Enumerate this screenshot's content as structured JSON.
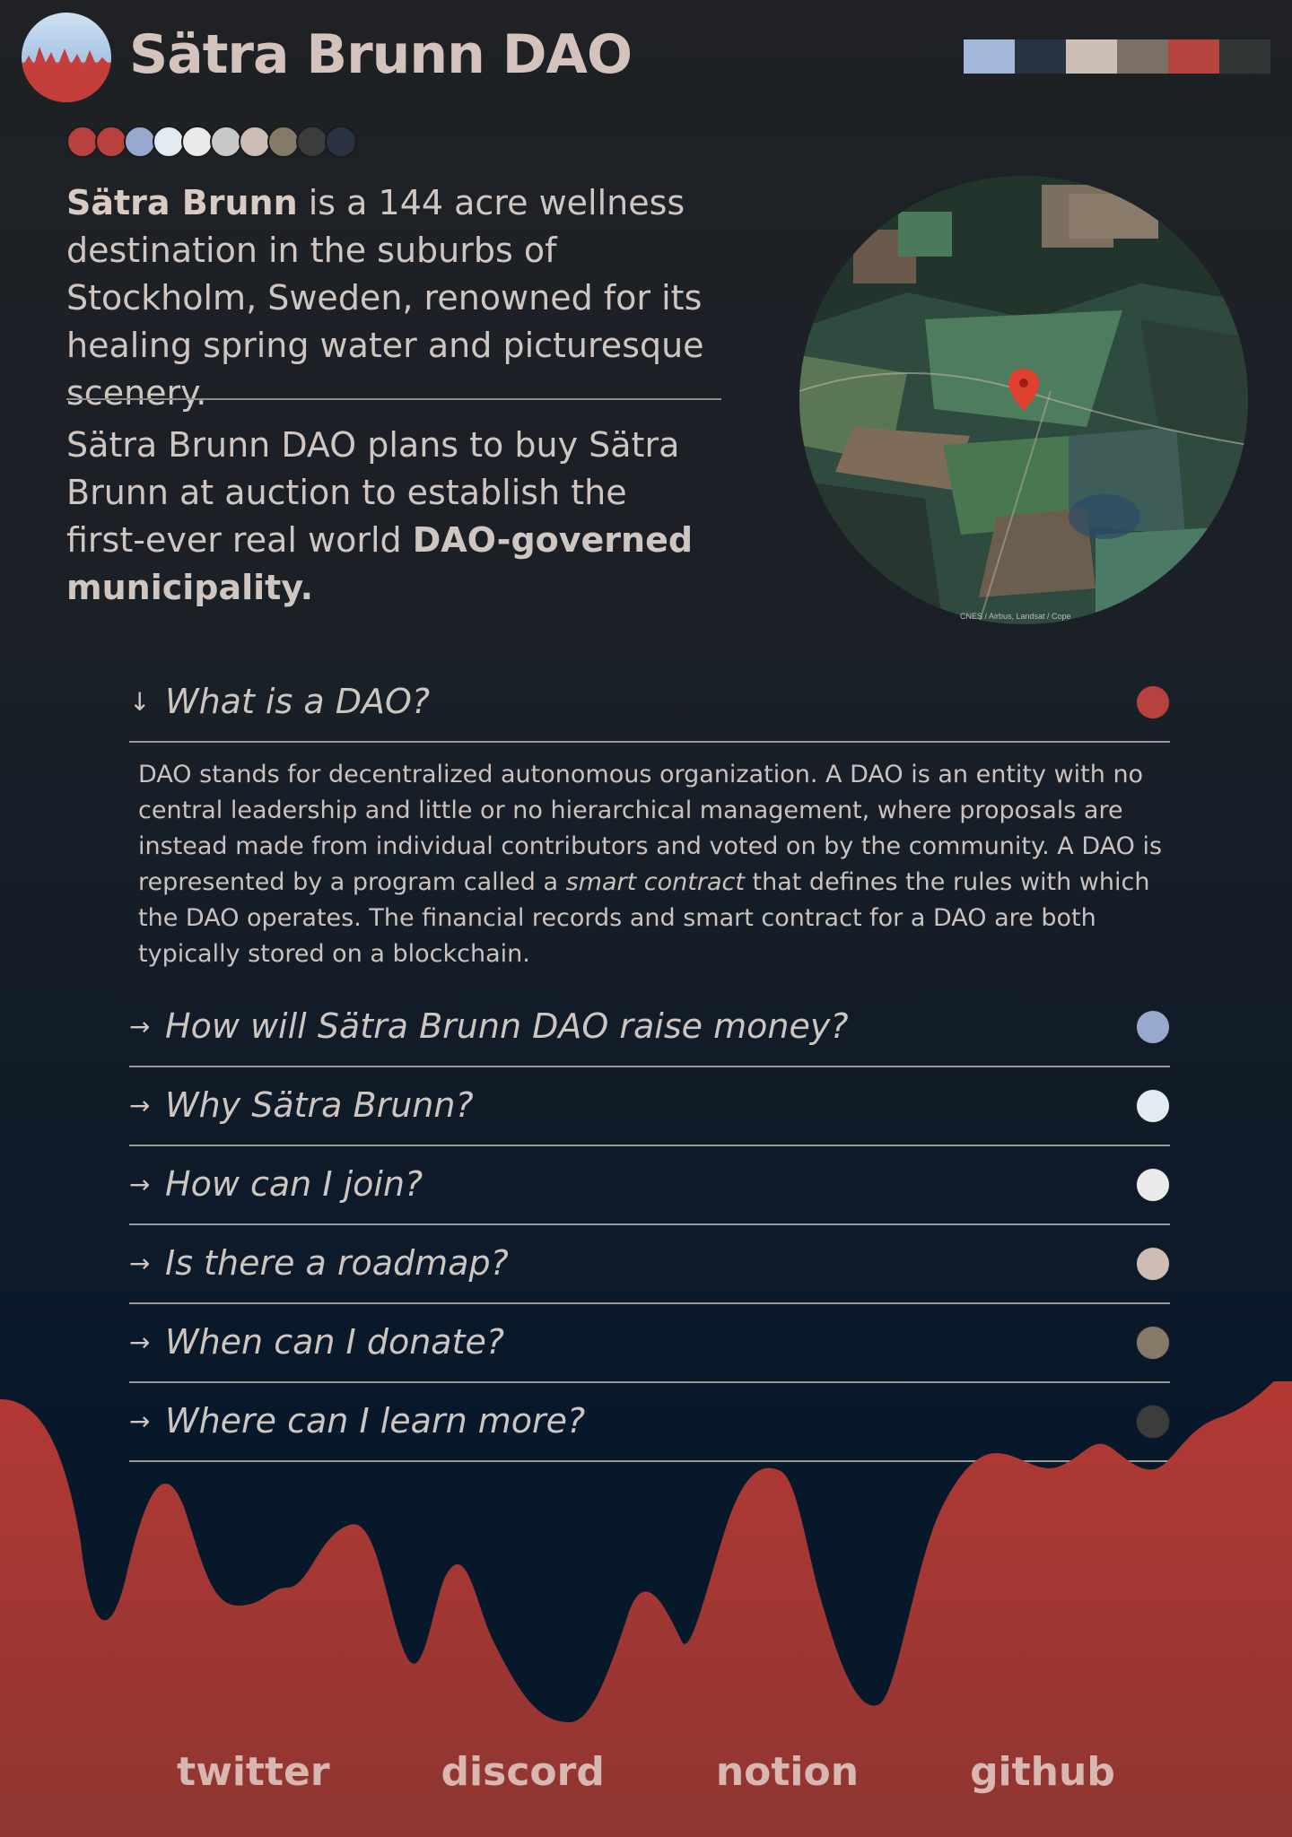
{
  "header": {
    "title": "Sätra Brunn DAO",
    "palette": [
      "#a3b7da",
      "#2a3344",
      "#cdbfb8",
      "#7b7063",
      "#b8443f",
      "#313536"
    ]
  },
  "color_dots": [
    "#b6413e",
    "#b8413f",
    "#98a9cf",
    "#e3ebf2",
    "#eaeaea",
    "#c8c8c8",
    "#cdbdb5",
    "#857967",
    "#3b3d3c",
    "#2b3243"
  ],
  "intro": {
    "p1_bold": "Sätra Brunn",
    "p1_rest": " is a 144 acre wellness destination in the suburbs of Stockholm, Sweden, renowned for its healing spring water and picturesque scenery.",
    "p2_start": "Sätra Brunn DAO plans to buy Sätra Brunn at auction to establish the first-ever real world ",
    "p2_bold": "DAO-governed municipality."
  },
  "map": {
    "credit": "CNES / Airbus, Landsat / Cope"
  },
  "faq": {
    "items": [
      {
        "arrow": "↓",
        "question": "What is a DAO?",
        "color": "#b6413e",
        "open": true
      },
      {
        "arrow": "→",
        "question": "How will Sätra Brunn DAO raise money?",
        "color": "#98a9cf"
      },
      {
        "arrow": "→",
        "question": "Why Sätra Brunn?",
        "color": "#e3ebf2"
      },
      {
        "arrow": "→",
        "question": "How can I join?",
        "color": "#eaeaea"
      },
      {
        "arrow": "→",
        "question": "Is there a roadmap?",
        "color": "#cdbdb5"
      },
      {
        "arrow": "→",
        "question": "When can I donate?",
        "color": "#857967"
      },
      {
        "arrow": "→",
        "question": "Where can I learn more?",
        "color": "#3b3d3c"
      }
    ],
    "answer": {
      "part1": "DAO stands for decentralized autonomous organization. A DAO is an entity with no central leadership and little or no hierarchical management, where proposals are instead made from individual contributors and voted on by the community. A DAO is represented by a program called a ",
      "em": "smart contract",
      "part2": " that defines the rules with which the DAO operates. The financial records and smart contract for a DAO are both typically stored on a blockchain."
    }
  },
  "footer": {
    "links": [
      "twitter",
      "discord",
      "notion",
      "github"
    ]
  }
}
